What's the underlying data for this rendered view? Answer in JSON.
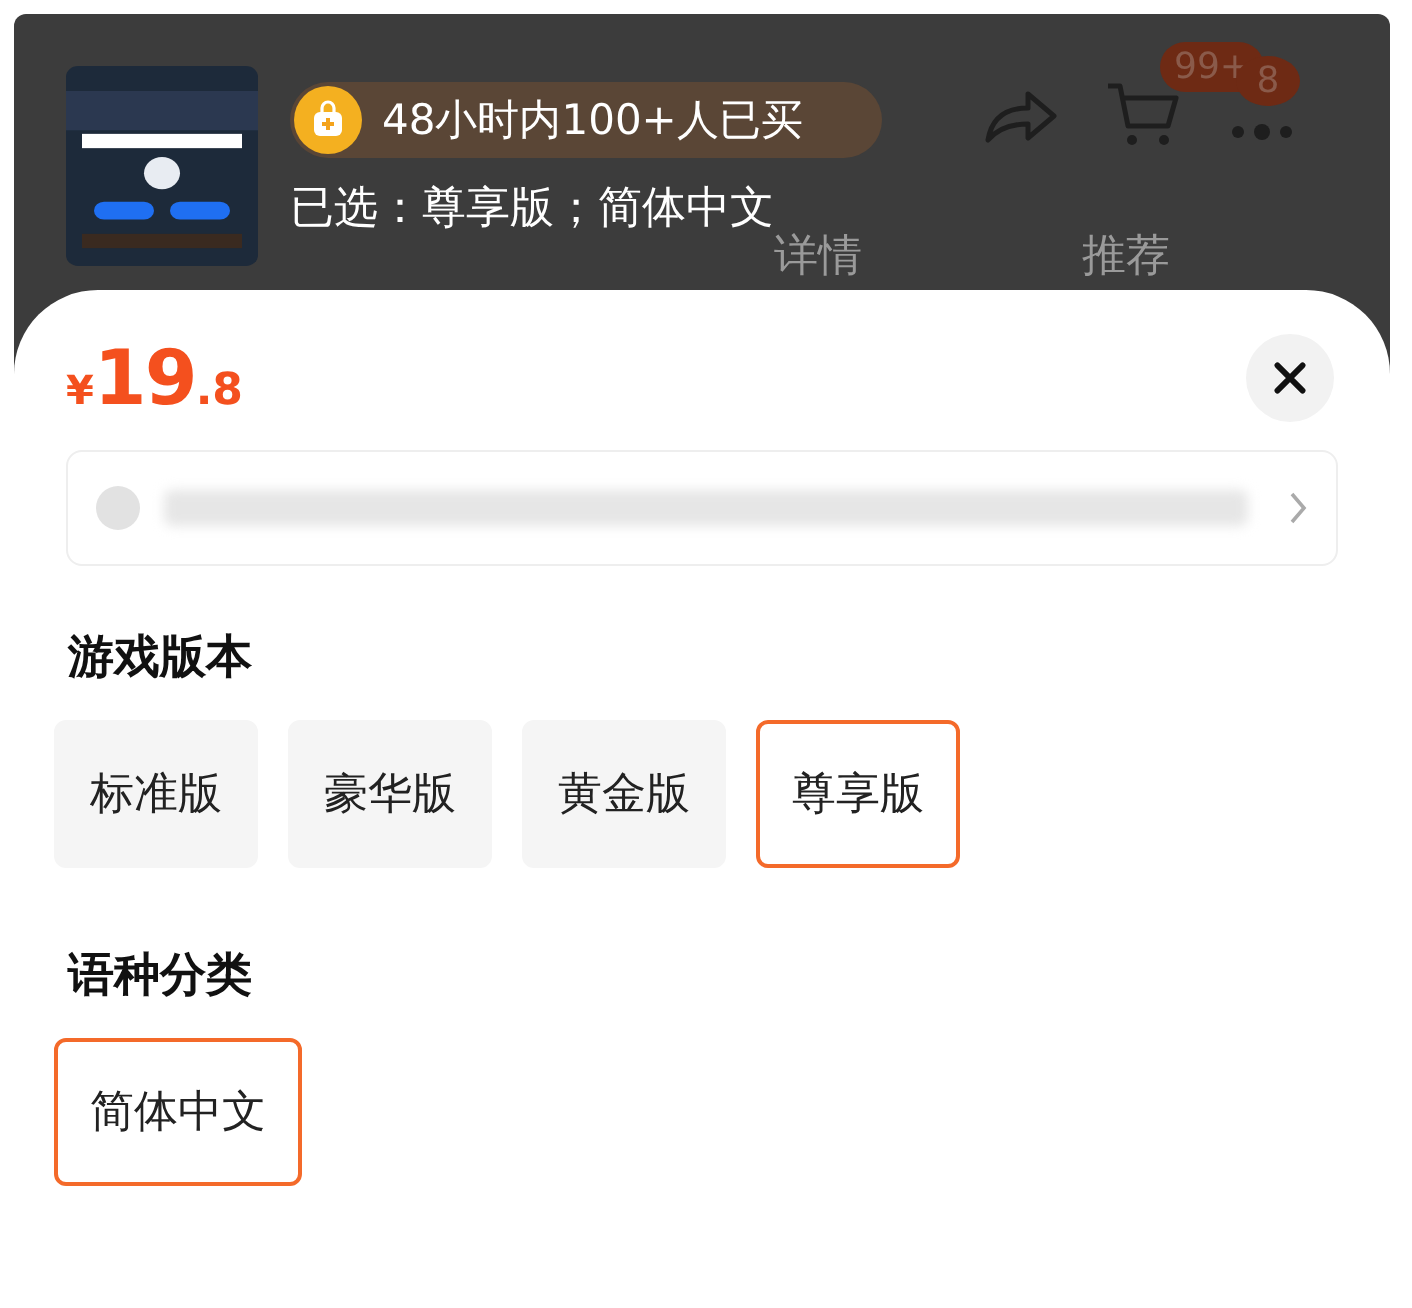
{
  "header": {
    "buyers_badge": "48小时内100+人已买",
    "selection": "已选：尊享版；简体中文",
    "cart_count": "99+",
    "more_count": "8",
    "tabs": [
      {
        "label": "详情",
        "selected": false
      },
      {
        "label": "推荐",
        "selected": false
      }
    ]
  },
  "price": {
    "currency": "¥",
    "integer": "19",
    "decimal": ".8"
  },
  "groups": [
    {
      "title": "游戏版本",
      "options": [
        {
          "label": "标准版",
          "selected": false
        },
        {
          "label": "豪华版",
          "selected": false
        },
        {
          "label": "黄金版",
          "selected": false
        },
        {
          "label": "尊享版",
          "selected": true
        }
      ]
    },
    {
      "title": "语种分类",
      "options": [
        {
          "label": "简体中文",
          "selected": true
        }
      ]
    }
  ]
}
